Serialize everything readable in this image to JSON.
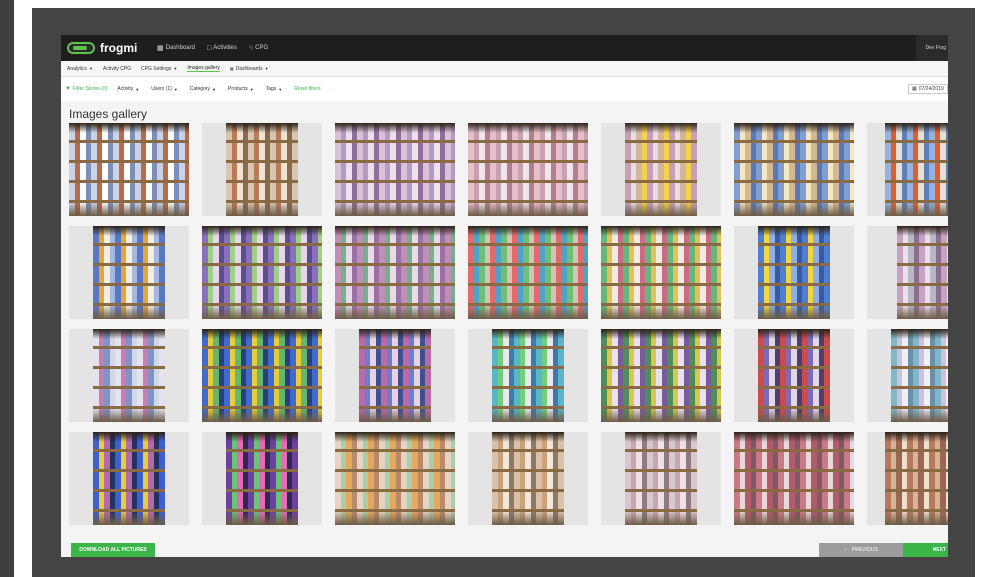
{
  "app": {
    "brand": "frogmi",
    "nav": [
      {
        "label": "Dashboard",
        "icon": "grid-icon"
      },
      {
        "label": "Activities",
        "icon": "calendar-icon"
      },
      {
        "label": "CPG",
        "icon": "cart-icon"
      }
    ],
    "user": "Dev Frog"
  },
  "subnav": [
    {
      "label": "Analytics",
      "caret": true,
      "active": false
    },
    {
      "label": "Activity CPG",
      "caret": false,
      "active": false
    },
    {
      "label": "CPG Settings",
      "caret": true,
      "active": false
    },
    {
      "label": "Images gallery",
      "caret": false,
      "active": true
    },
    {
      "label": "Dashboards",
      "caret": true,
      "active": false
    }
  ],
  "filters": {
    "toggle": "Filter Stores (0)",
    "items": [
      "Activity",
      "Users (1)",
      "Category",
      "Products",
      "Tags"
    ],
    "reset": "Reset filters",
    "date": "07/24/2019"
  },
  "gallery": {
    "title": "Images gallery",
    "images": [
      {
        "fill": 1.0,
        "palette": [
          "#c9d3e6",
          "#b86a4a",
          "#ffffff",
          "#7d8fb8"
        ]
      },
      {
        "fill": 0.6,
        "palette": [
          "#d7c7b2",
          "#b97a55",
          "#efe4d6",
          "#8a6b50"
        ]
      },
      {
        "fill": 1.0,
        "palette": [
          "#d9c2d8",
          "#b49ac4",
          "#ece0ea",
          "#8f6f9a"
        ]
      },
      {
        "fill": 1.0,
        "palette": [
          "#e7bfc9",
          "#c8a0b4",
          "#f0e6ec",
          "#b08090"
        ]
      },
      {
        "fill": 0.6,
        "palette": [
          "#c7a0b8",
          "#e8dde5",
          "#d2b59c",
          "#f4d24a"
        ]
      },
      {
        "fill": 1.0,
        "palette": [
          "#7f9ed3",
          "#f3e7c6",
          "#d5b890",
          "#5a78b5"
        ]
      },
      {
        "fill": 0.7,
        "palette": [
          "#96b3e0",
          "#e25c2c",
          "#e6e0d6",
          "#5d7fb8"
        ]
      },
      {
        "fill": 0.6,
        "palette": [
          "#5a77c6",
          "#e0a93a",
          "#f3eee3",
          "#a7b8df"
        ]
      },
      {
        "fill": 1.0,
        "palette": [
          "#8a6fbf",
          "#9ecf86",
          "#e7d6ee",
          "#5c4d8f"
        ]
      },
      {
        "fill": 1.0,
        "palette": [
          "#bf8fb5",
          "#75b08a",
          "#e7dce6",
          "#9a70a6"
        ]
      },
      {
        "fill": 1.0,
        "palette": [
          "#e26a6a",
          "#4fa3c9",
          "#6fbf77",
          "#d1c6b6"
        ]
      },
      {
        "fill": 1.0,
        "palette": [
          "#66b77a",
          "#e3c25a",
          "#f1ebe3",
          "#c96d86"
        ]
      },
      {
        "fill": 0.6,
        "palette": [
          "#4e7fd1",
          "#f2d63d",
          "#8fb0e6",
          "#3a5aa0"
        ]
      },
      {
        "fill": 0.5,
        "palette": [
          "#c7a2c2",
          "#e8e2e8",
          "#b8b8c8",
          "#8b6f8f"
        ]
      },
      {
        "fill": 0.6,
        "palette": [
          "#e3e3ee",
          "#c87db3",
          "#7e94c9",
          "#d2d7e6"
        ]
      },
      {
        "fill": 1.0,
        "palette": [
          "#3e6ad1",
          "#e7cd3b",
          "#65b96f",
          "#2c3f78"
        ]
      },
      {
        "fill": 0.6,
        "palette": [
          "#b96aa8",
          "#6a7fcf",
          "#e6d2e0",
          "#3f4f8f"
        ]
      },
      {
        "fill": 0.6,
        "palette": [
          "#5ab5c8",
          "#6fcf7a",
          "#e9e7f0",
          "#3b7ba6"
        ]
      },
      {
        "fill": 1.0,
        "palette": [
          "#4c8f5b",
          "#d7c84a",
          "#e8e2f0",
          "#7a5a9e"
        ]
      },
      {
        "fill": 0.6,
        "palette": [
          "#cf4b4b",
          "#7e6bb3",
          "#e0d7e8",
          "#4a3f6f"
        ]
      },
      {
        "fill": 0.6,
        "palette": [
          "#7fb9c9",
          "#cfc0e0",
          "#eef0f3",
          "#6a8fa6"
        ]
      },
      {
        "fill": 0.6,
        "palette": [
          "#3d5fd0",
          "#e7cf3a",
          "#b86aa8",
          "#22335f"
        ]
      },
      {
        "fill": 0.6,
        "palette": [
          "#6e3fa3",
          "#67c47a",
          "#e66bb4",
          "#2c2a4f"
        ]
      },
      {
        "fill": 1.0,
        "palette": [
          "#e5d3c3",
          "#a8cfa9",
          "#e6a85c",
          "#b98a6a"
        ]
      },
      {
        "fill": 0.6,
        "palette": [
          "#d9c2a7",
          "#c9a27c",
          "#f1e6d8",
          "#8b7a66"
        ]
      },
      {
        "fill": 0.6,
        "palette": [
          "#d8c7d0",
          "#c9a4b3",
          "#efe2e6",
          "#8f7a83"
        ]
      },
      {
        "fill": 1.0,
        "palette": [
          "#c97a86",
          "#e6d8dc",
          "#b35b6a",
          "#7d5a66"
        ]
      },
      {
        "fill": 0.7,
        "palette": [
          "#b8795c",
          "#d6b49a",
          "#9c6650",
          "#efe0d2"
        ]
      }
    ]
  },
  "actions": {
    "download": "DOWNLOAD ALL PICTURES",
    "previous": "PREVIOUS",
    "next": "NEXT"
  },
  "colors": {
    "accent_green": "#3bb54a",
    "navbar": "#1e1e1e",
    "frame": "#444444"
  }
}
